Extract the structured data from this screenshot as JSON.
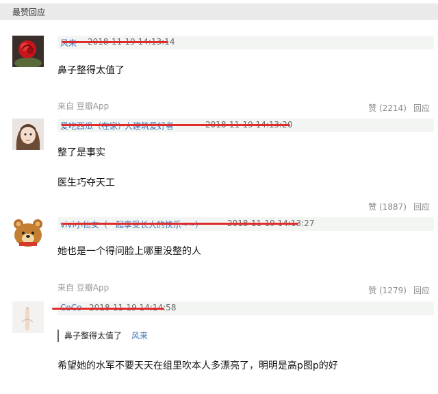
{
  "header": {
    "title": "最赞回应"
  },
  "comments": [
    {
      "author": "风来",
      "time": "2018-11-19 14:13:14",
      "paragraphs": [
        "鼻子整得太值了"
      ],
      "source": "来自 豆瓣App",
      "likes": "赞 (2214)",
      "reply": "回应",
      "avatar": "red-rose"
    },
    {
      "author": "爱吃西瓜（在家）·大建筑爱好者",
      "time": "2018-11-19 14:13:20",
      "paragraphs": [
        "整了是事实",
        "医生巧夺天工"
      ],
      "source": "",
      "likes": "赞 (1887)",
      "reply": "回应",
      "avatar": "girl-portrait"
    },
    {
      "author": "vivi小仙女（一起享受长大的快乐~~）",
      "time": "2018-11-19 14:13:27",
      "paragraphs": [
        "她也是一个得问脸上哪里没整的人"
      ],
      "source": "来自 豆瓣App",
      "likes": "赞 (1279)",
      "reply": "回应",
      "avatar": "rilakkuma"
    },
    {
      "author": "CoCo",
      "time": "2018-11-19 14:14:58",
      "quote": {
        "text": "鼻子整得太值了",
        "author": "风来"
      },
      "paragraphs": [
        "希望她的水军不要天天在组里吹本人多漂亮了，明明是高p图p的好"
      ],
      "source": "",
      "likes": "",
      "reply": "",
      "avatar": "hand-sketch"
    }
  ],
  "colors": {
    "link": "#3b71b5",
    "redaction": "#e02b2b",
    "header_bg": "#eaeaea"
  }
}
